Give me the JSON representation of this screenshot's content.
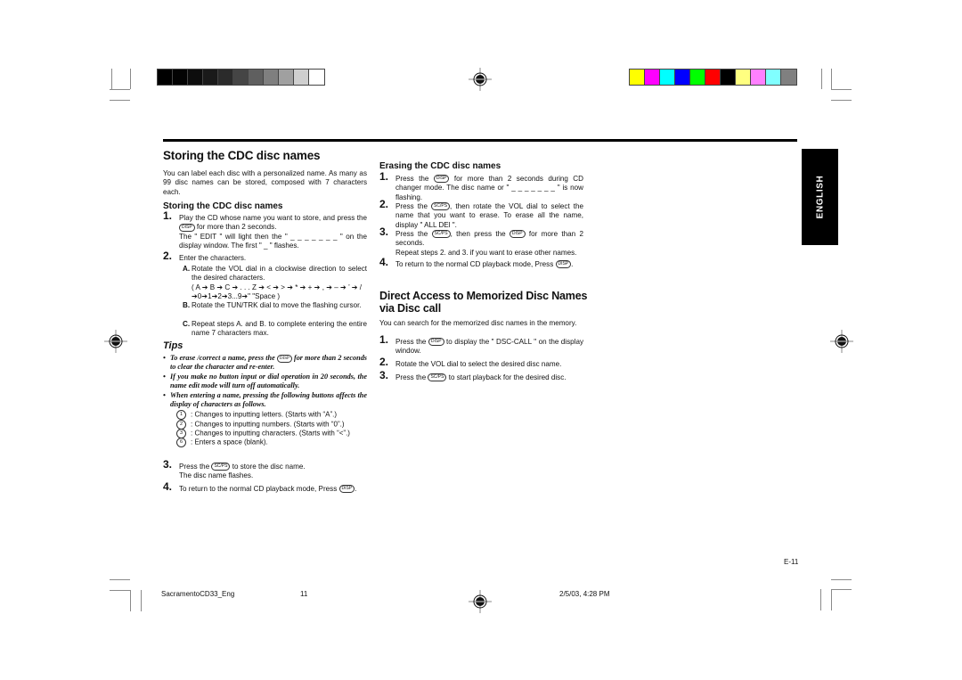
{
  "registration": {
    "grayscale_swatches": [
      "#000000",
      "#030303",
      "#0d0d0d",
      "#1a1a1a",
      "#2b2b2b",
      "#454545",
      "#5f5f5f",
      "#7f7f7f",
      "#a0a0a0",
      "#cfcfcf",
      "#ffffff"
    ],
    "color_swatches": [
      "#ffff00",
      "#ff00ff",
      "#00ffff",
      "#0000ff",
      "#00ff00",
      "#ff0000",
      "#000000",
      "#ffff80",
      "#ff80ff",
      "#80ffff",
      "#808080"
    ]
  },
  "side_tab": {
    "label": "ENGLISH"
  },
  "left": {
    "title": "Storing the CDC disc names",
    "intro": "You can label each disc with a personalized name. As many as 99 disc names can be stored, composed with 7 characters each.",
    "subheading": "Storing the CDC disc names",
    "steps": [
      {
        "num": "1.",
        "parts": [
          "Play the CD whose name you want to store, and press the ",
          "DISP",
          " for more than 2 seconds."
        ],
        "extra": "The \" EDIT \" will light then the \" _ _ _ _ _ _ _ \" on the display window. The first \" _ \" flashes."
      },
      {
        "num": "2.",
        "text": "Enter the characters."
      },
      {
        "num": "3.",
        "parts": [
          "Press the ",
          "SC/PS",
          " to store the disc name."
        ],
        "extra": "The disc name flashes."
      },
      {
        "num": "4.",
        "parts": [
          "To return to the normal CD playback mode, Press ",
          "DISP",
          "."
        ]
      }
    ],
    "substeps": [
      {
        "label": "A.",
        "text": "Rotate the VOL dial in a clockwise direction to select the desired characters.",
        "sequence1": "( A ➔ B ➔ C ➔ . . . Z ➔ < ➔ > ➔ * ➔ + ➔ , ➔ – ➔ ’ ➔ /",
        "sequence2": "➔0➔1➔2➔3...9➔\"  \"Space )"
      },
      {
        "label": "B.",
        "text": "Rotate the TUN/TRK dial to move the flashing cursor."
      },
      {
        "label": "C.",
        "text": "Repeat steps A. and B. to complete entering the entire name 7 characters max."
      }
    ],
    "tips": {
      "heading": "Tips",
      "items": [
        {
          "before": "To erase /correct a name, press the ",
          "button": "DISP",
          "after": " for more than 2 seconds to clear the character and re-enter."
        },
        {
          "before": "If you make no button input or dial operation in 20 seconds, the name edit mode will turn off automatically."
        },
        {
          "before": "When entering a name, pressing the following buttons affects the display of characters as follows."
        }
      ],
      "keys": [
        {
          "key": "1",
          "text": ":  Changes to inputting letters. (Starts with “A”.)"
        },
        {
          "key": "2",
          "text": ":  Changes to inputting numbers. (Starts with “0”.)"
        },
        {
          "key": "3",
          "text": ":  Changes to inputting characters. (Starts with “<”.)"
        },
        {
          "key": "6",
          "text": ":  Enters a space (blank)."
        }
      ]
    }
  },
  "right": {
    "erase_heading": "Erasing the CDC disc names",
    "erase_steps": [
      {
        "num": "1.",
        "parts": [
          "Press the ",
          "DISP",
          " for more than 2 seconds during CD changer mode. The disc name or \" _ _ _ _ _ _ _ \" is now flashing."
        ]
      },
      {
        "num": "2.",
        "parts": [
          "Press the ",
          "SC/PS",
          ", then rotate the VOL dial to select the name that you want to erase. To erase all the name, display \" ALL DEl \"."
        ]
      },
      {
        "num": "3.",
        "parts": [
          "Press the ",
          "SC/PS",
          ", then press the ",
          "DISP",
          " for more than 2 seconds."
        ],
        "extra": "Repeat steps 2. and 3. if you want to erase other names."
      },
      {
        "num": "4.",
        "parts": [
          "To return to the normal CD playback mode, Press ",
          "DISP",
          "."
        ]
      }
    ],
    "direct_title": "Direct Access to Memorized Disc Names via Disc call",
    "direct_intro": "You can search for the memorized disc names in the memory.",
    "direct_steps": [
      {
        "num": "1.",
        "parts": [
          "Press the ",
          "DISP",
          " to display the \" DSC-CALL \" on the display window."
        ]
      },
      {
        "num": "2.",
        "parts": [
          "Rotate the VOL dial to select the desired disc name."
        ]
      },
      {
        "num": "3.",
        "parts": [
          "Press the ",
          "SC/PS",
          " to start playback for the desired disc."
        ]
      }
    ]
  },
  "page_number": "E-11",
  "footer": {
    "filename": "SacramentoCD33_Eng",
    "page": "11",
    "timestamp": "2/5/03, 4:28 PM"
  }
}
